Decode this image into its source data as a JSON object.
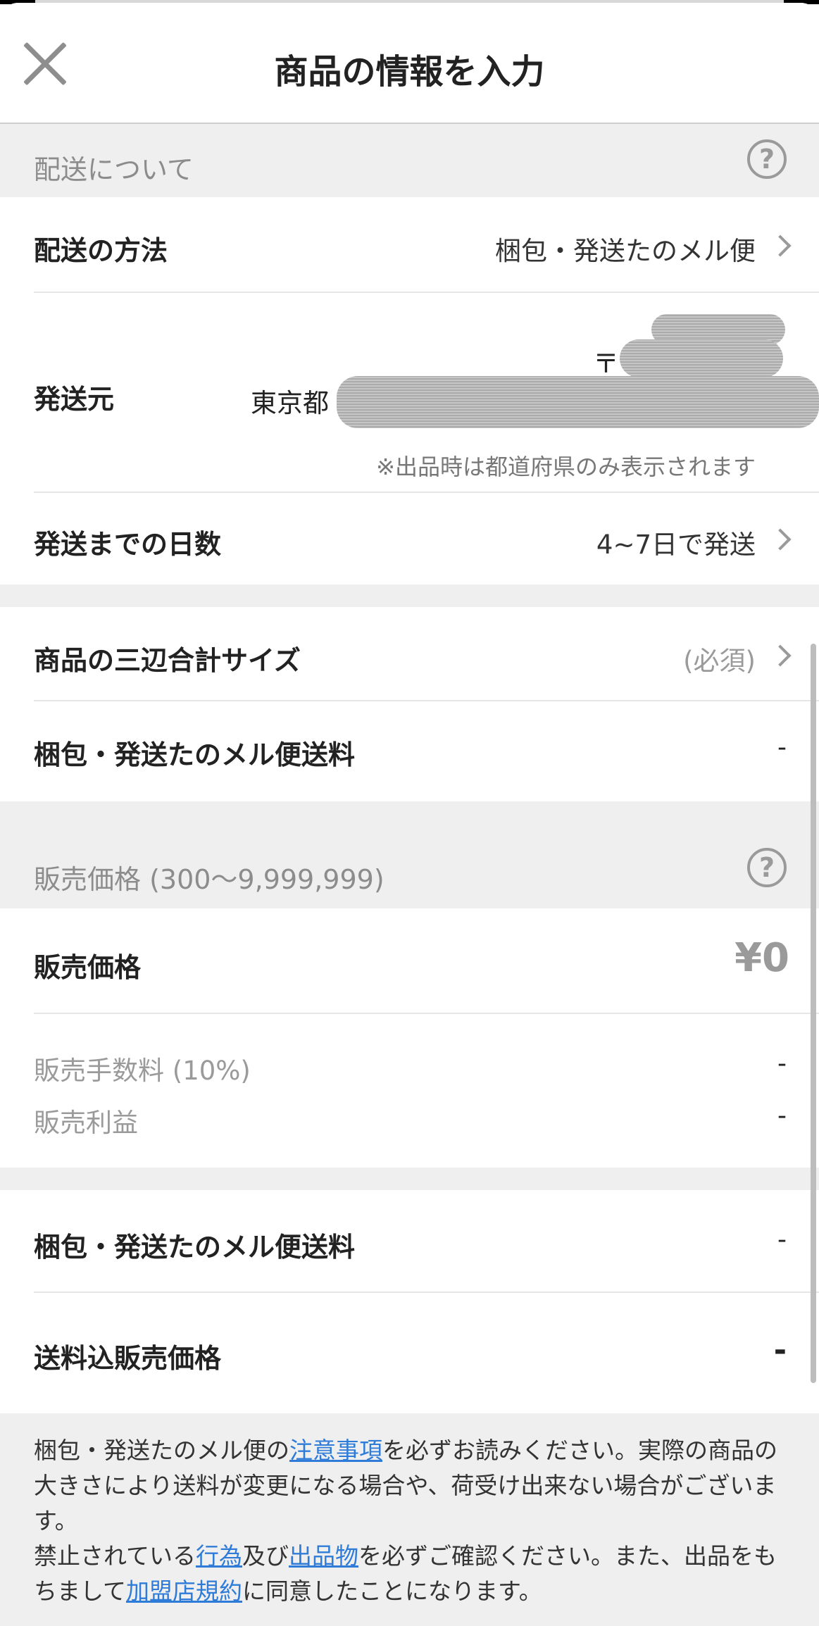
{
  "header": {
    "title": "商品の情報を入力",
    "close_icon": "close-icon"
  },
  "shipping_section": {
    "title": "配送について",
    "help_icon": "?",
    "method": {
      "label": "配送の方法",
      "value": "梱包・発送たのメル便"
    },
    "origin": {
      "label": "発送元",
      "postal_mark": "〒",
      "address_prefix": "東京都",
      "note": "※出品時は都道府県のみ表示されます"
    },
    "days": {
      "label": "発送までの日数",
      "value": "4~7日で発送"
    }
  },
  "size_section": {
    "size": {
      "label": "商品の三辺合計サイズ",
      "value": "(必須)"
    },
    "fee": {
      "label": "梱包・発送たのメル便送料",
      "value": "-"
    }
  },
  "price_section": {
    "title": "販売価格 (300～9,999,999)",
    "help_icon": "?",
    "price": {
      "label": "販売価格",
      "value": "¥0"
    },
    "commission": {
      "label": "販売手数料 (10%)",
      "value": "-"
    },
    "profit": {
      "label": "販売利益",
      "value": "-"
    }
  },
  "total_section": {
    "fee": {
      "label": "梱包・発送たのメル便送料",
      "value": "-"
    },
    "total": {
      "label": "送料込販売価格",
      "value": "-"
    }
  },
  "notice": {
    "p1_a": "梱包・発送たのメル便の",
    "p1_link": "注意事項",
    "p1_b": "を必ずお読みください。実際の商品の大きさにより送料が変更になる場合や、荷受け出来ない場合がございます。",
    "p2_a": "禁止されている",
    "p2_link1": "行為",
    "p2_b": "及び",
    "p2_link2": "出品物",
    "p2_c": "を必ずご確認ください。また、出品をもちまして",
    "p2_link3": "加盟店規約",
    "p2_d": "に同意したことになります。"
  },
  "colors": {
    "link": "#2f7cd8",
    "section_bg": "#efefef",
    "muted_text": "#9a9a9a"
  }
}
